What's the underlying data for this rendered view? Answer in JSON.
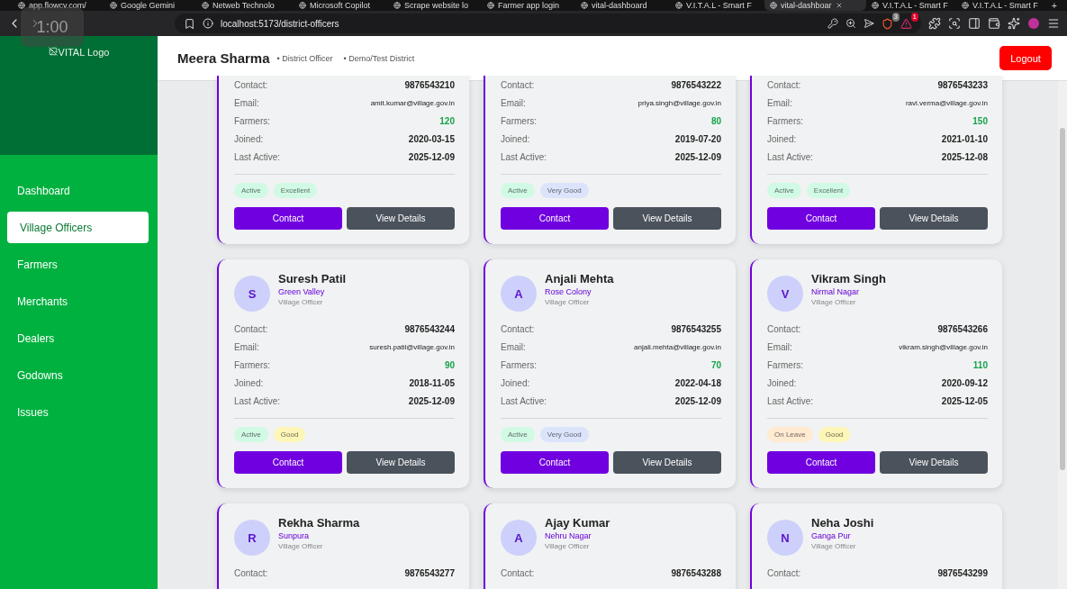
{
  "browser": {
    "tabs": [
      {
        "title": "app.flowcv.com/",
        "selected": false
      },
      {
        "title": "Google Gemini",
        "selected": false
      },
      {
        "title": "Netweb Technolo",
        "selected": false
      },
      {
        "title": "Microsoft Copilot",
        "selected": false
      },
      {
        "title": "Scrape website lo",
        "selected": false
      },
      {
        "title": "Farmer app login",
        "selected": false
      },
      {
        "title": "vital-dashboard",
        "selected": false
      },
      {
        "title": "V.I.T.A.L - Smart F",
        "selected": false
      },
      {
        "title": "vital-dashboar",
        "selected": true
      },
      {
        "title": "V.I.T.A.L - Smart F",
        "selected": false
      },
      {
        "title": "V.I.T.A.L - Smart F",
        "selected": false
      }
    ],
    "new_tab": "+",
    "url": "localhost:5173/district-officers",
    "shield_count": "3",
    "alert_count": "1",
    "timer": "1:00"
  },
  "sidebar": {
    "logo_alt": "VITAL Logo",
    "items": [
      {
        "label": "Dashboard",
        "selected": false
      },
      {
        "label": "Village Officers",
        "selected": true
      },
      {
        "label": "Farmers",
        "selected": false
      },
      {
        "label": "Merchants",
        "selected": false
      },
      {
        "label": "Dealers",
        "selected": false
      },
      {
        "label": "Godowns",
        "selected": false
      },
      {
        "label": "Issues",
        "selected": false
      }
    ]
  },
  "header": {
    "name": "Meera Sharma",
    "role": "• District Officer",
    "district": "• Demo/Test District",
    "logout": "Logout"
  },
  "cards": [
    {
      "fields": [
        {
          "kind": "phone",
          "label": "Contact:",
          "value": "9876543210"
        },
        {
          "kind": "email",
          "label": "Email:",
          "value": "amit.kumar@village.gov.in"
        },
        {
          "kind": "count",
          "label": "Farmers:",
          "value": "120"
        },
        {
          "kind": "date",
          "label": "Joined:",
          "value": "2020-03-15"
        },
        {
          "kind": "date",
          "label": "Last Active:",
          "value": "2025-12-09"
        }
      ],
      "badges": [
        {
          "text": "Active",
          "color": "#d1fae5"
        },
        {
          "text": "Excellent",
          "color": "#d1fae5"
        }
      ],
      "buttons": [
        "Contact",
        "View Details"
      ]
    },
    {
      "fields": [
        {
          "kind": "phone",
          "label": "Contact:",
          "value": "9876543222"
        },
        {
          "kind": "email",
          "label": "Email:",
          "value": "priya.singh@village.gov.in"
        },
        {
          "kind": "count",
          "label": "Farmers:",
          "value": "80"
        },
        {
          "kind": "date",
          "label": "Joined:",
          "value": "2019-07-20"
        },
        {
          "kind": "date",
          "label": "Last Active:",
          "value": "2025-12-09"
        }
      ],
      "badges": [
        {
          "text": "Active",
          "color": "#d1fae5"
        },
        {
          "text": "Very Good",
          "color": "#dbe4fb"
        }
      ],
      "buttons": [
        "Contact",
        "View Details"
      ]
    },
    {
      "fields": [
        {
          "kind": "phone",
          "label": "Contact:",
          "value": "9876543233"
        },
        {
          "kind": "email",
          "label": "Email:",
          "value": "ravi.verma@village.gov.in"
        },
        {
          "kind": "count",
          "label": "Farmers:",
          "value": "150"
        },
        {
          "kind": "date",
          "label": "Joined:",
          "value": "2021-01-10"
        },
        {
          "kind": "date",
          "label": "Last Active:",
          "value": "2025-12-08"
        }
      ],
      "badges": [
        {
          "text": "Active",
          "color": "#d1fae5"
        },
        {
          "text": "Excellent",
          "color": "#d1fae5"
        }
      ],
      "buttons": [
        "Contact",
        "View Details"
      ]
    },
    {
      "avatar": "S",
      "name": "Suresh Patil",
      "area": "Green Valley",
      "role": "Village Officer",
      "fields": [
        {
          "kind": "phone",
          "label": "Contact:",
          "value": "9876543244"
        },
        {
          "kind": "email",
          "label": "Email:",
          "value": "suresh.patil@village.gov.in"
        },
        {
          "kind": "count",
          "label": "Farmers:",
          "value": "90"
        },
        {
          "kind": "date",
          "label": "Joined:",
          "value": "2018-11-05"
        },
        {
          "kind": "date",
          "label": "Last Active:",
          "value": "2025-12-09"
        }
      ],
      "badges": [
        {
          "text": "Active",
          "color": "#d1fae5"
        },
        {
          "text": "Good",
          "color": "#fdf6b8"
        }
      ],
      "buttons": [
        "Contact",
        "View Details"
      ]
    },
    {
      "avatar": "A",
      "name": "Anjali Mehta",
      "area": "Rose Colony",
      "role": "Village Officer",
      "fields": [
        {
          "kind": "phone",
          "label": "Contact:",
          "value": "9876543255"
        },
        {
          "kind": "email",
          "label": "Email:",
          "value": "anjali.mehta@village.gov.in"
        },
        {
          "kind": "count",
          "label": "Farmers:",
          "value": "70"
        },
        {
          "kind": "date",
          "label": "Joined:",
          "value": "2022-04-18"
        },
        {
          "kind": "date",
          "label": "Last Active:",
          "value": "2025-12-09"
        }
      ],
      "badges": [
        {
          "text": "Active",
          "color": "#d1fae5"
        },
        {
          "text": "Very Good",
          "color": "#dbe4fb"
        }
      ],
      "buttons": [
        "Contact",
        "View Details"
      ]
    },
    {
      "avatar": "V",
      "name": "Vikram Singh",
      "area": "Nirmal Nagar",
      "role": "Village Officer",
      "fields": [
        {
          "kind": "phone",
          "label": "Contact:",
          "value": "9876543266"
        },
        {
          "kind": "email",
          "label": "Email:",
          "value": "vikram.singh@village.gov.in"
        },
        {
          "kind": "count",
          "label": "Farmers:",
          "value": "110"
        },
        {
          "kind": "date",
          "label": "Joined:",
          "value": "2020-09-12"
        },
        {
          "kind": "date",
          "label": "Last Active:",
          "value": "2025-12-05"
        }
      ],
      "badges": [
        {
          "text": "On Leave",
          "color": "#ffead2"
        },
        {
          "text": "Good",
          "color": "#fdf6b8"
        }
      ],
      "buttons": [
        "Contact",
        "View Details"
      ]
    },
    {
      "avatar": "R",
      "name": "Rekha Sharma",
      "area": "Sunpura",
      "role": "Village Officer",
      "fields": [
        {
          "kind": "phone",
          "label": "Contact:",
          "value": "9876543277"
        }
      ]
    },
    {
      "avatar": "A",
      "name": "Ajay Kumar",
      "area": "Nehru Nagar",
      "role": "Village Officer",
      "fields": [
        {
          "kind": "phone",
          "label": "Contact:",
          "value": "9876543288"
        }
      ]
    },
    {
      "avatar": "N",
      "name": "Neha Joshi",
      "area": "Ganga Pur",
      "role": "Village Officer",
      "fields": [
        {
          "kind": "phone",
          "label": "Contact:",
          "value": "9876543299"
        }
      ]
    }
  ]
}
